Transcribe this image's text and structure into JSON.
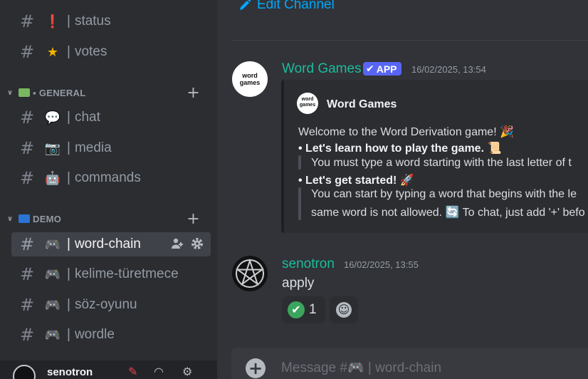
{
  "sidebar": {
    "channels_top": [
      {
        "emoji": "❗",
        "emoji_color": "#e83a3a",
        "label": "status"
      },
      {
        "emoji": "★",
        "emoji_color": "#f4b400",
        "label": "votes"
      }
    ],
    "categories": [
      {
        "chevron": "∨",
        "label": "▪ GENERAL",
        "add": "+",
        "emoji_color": "#7bb661"
      },
      {
        "chevron": "∨",
        "label": "DEMO",
        "add": "+",
        "emoji_color": "#2b73d4"
      }
    ],
    "general_channels": [
      {
        "emoji": "💬",
        "label": "chat"
      },
      {
        "emoji": "📷",
        "label": "media"
      },
      {
        "emoji": "🤖",
        "label": "commands"
      }
    ],
    "demo_channels": [
      {
        "emoji": "🎮",
        "label": "word-chain",
        "active": true
      },
      {
        "emoji": "🎮",
        "label": "kelime-türetmece"
      },
      {
        "emoji": "🎮",
        "label": "söz-oyunu"
      },
      {
        "emoji": "🎮",
        "label": "wordle"
      }
    ],
    "hash": "#",
    "separator": "|",
    "user": {
      "name": "senotron"
    }
  },
  "main": {
    "edit_channel": "Edit Channel",
    "messages": [
      {
        "author": "Word Games",
        "author_color": "#1abc9c",
        "badge": "APP",
        "timestamp": "16/02/2025, 13:54",
        "avatar_text": "word games",
        "embed": {
          "author": "Word Games",
          "lines": [
            {
              "text": "Welcome to the Word Derivation game! 🎉",
              "bold": false
            },
            {
              "text": "• Let's learn how to play the game. 📜",
              "bold": true
            },
            {
              "text": "You must type a word starting with the last letter of t",
              "bold": false,
              "quote": true
            },
            {
              "text": "• Let's get started! 🚀",
              "bold": true
            },
            {
              "text": "You can start by typing a word that begins with the le",
              "bold": false,
              "quote": true
            },
            {
              "text": "same word is not allowed. 🔄 To chat, just add '+' befo",
              "bold": false,
              "quote": true
            }
          ]
        }
      },
      {
        "author": "senotron",
        "author_color": "#1abc9c",
        "timestamp": "16/02/2025, 13:55",
        "content": "apply",
        "reactions": [
          {
            "emoji": "✔",
            "count": "1",
            "color": "#3ba55d"
          },
          {
            "emoji": "☺",
            "count": "",
            "color": "#b5bac1"
          }
        ]
      }
    ],
    "composer": {
      "placeholder": "Message #🎮 | word-chain",
      "add": "+"
    }
  }
}
